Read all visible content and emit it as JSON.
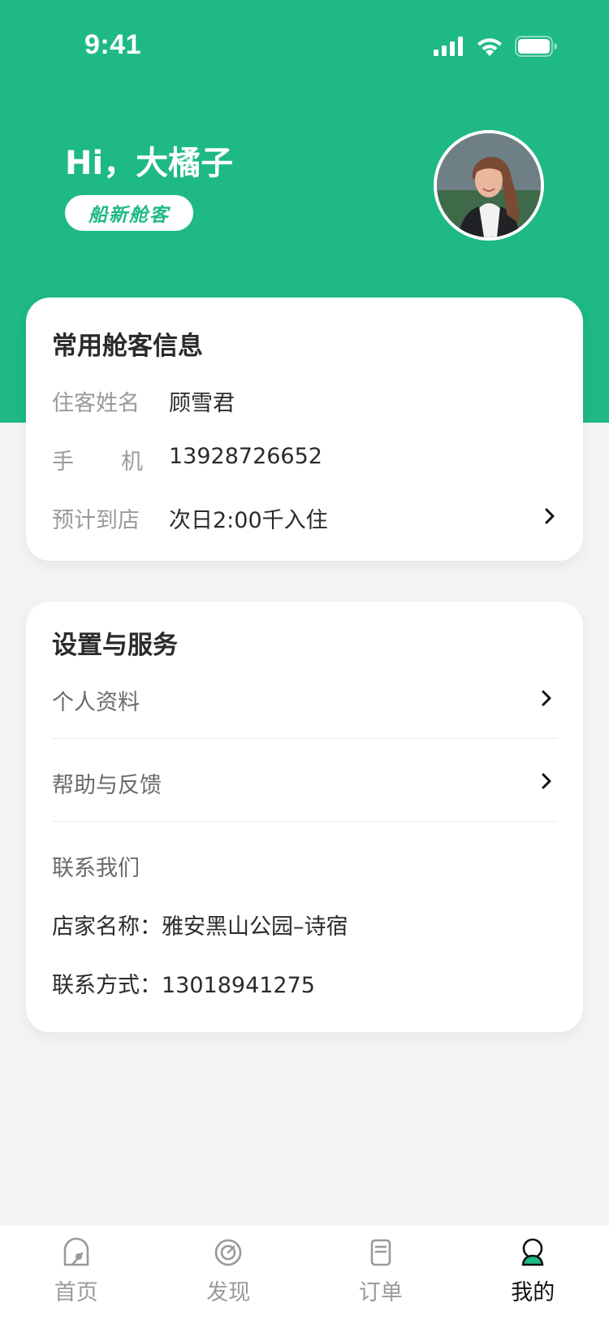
{
  "status_bar": {
    "time": "9:41"
  },
  "profile": {
    "greeting": "Hi，大橘子",
    "badge": "船新舱客"
  },
  "guest_card": {
    "title": "常用舱客信息",
    "rows": [
      {
        "label": "住客姓名",
        "value": "顾雪君"
      },
      {
        "label_chars": [
          "手",
          "机"
        ],
        "value": "13928726652"
      },
      {
        "label": "预计到店",
        "value": "次日2:00千入住"
      }
    ]
  },
  "settings_card": {
    "title": "设置与服务",
    "items": [
      {
        "label": "个人资料"
      },
      {
        "label": "帮助与反馈"
      }
    ],
    "contact": {
      "heading": "联系我们",
      "shop_line": "店家名称：雅安黑山公园–诗宿",
      "phone_line": "联系方式：13018941275"
    }
  },
  "tabbar": {
    "tabs": [
      {
        "label": "首页",
        "icon": "home-icon",
        "active": false
      },
      {
        "label": "发现",
        "icon": "discover-icon",
        "active": false
      },
      {
        "label": "订单",
        "icon": "orders-icon",
        "active": false
      },
      {
        "label": "我的",
        "icon": "profile-icon",
        "active": true
      }
    ]
  },
  "colors": {
    "brand": "#1eb985",
    "background": "#f4f4f6",
    "inactive_tab": "#9a9a9a"
  }
}
